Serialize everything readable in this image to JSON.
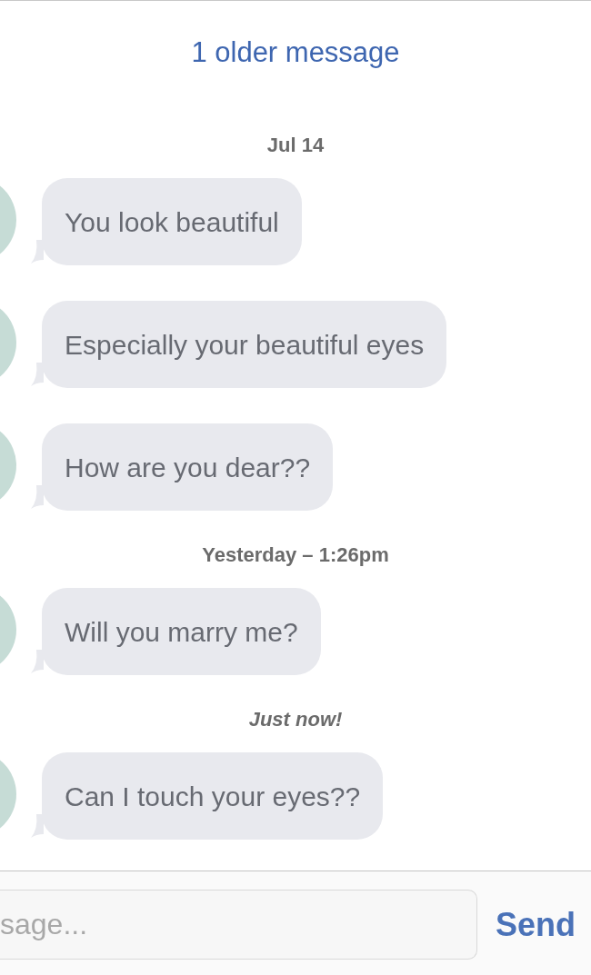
{
  "older_messages_link": "1 older message",
  "thread": [
    {
      "kind": "timestamp",
      "text": "Jul 14",
      "italic": false
    },
    {
      "kind": "message",
      "text": "You look beautiful"
    },
    {
      "kind": "message",
      "text": "Especially your beautiful eyes"
    },
    {
      "kind": "message",
      "text": "How are you dear??"
    },
    {
      "kind": "timestamp",
      "text": "Yesterday – 1:26pm",
      "italic": false
    },
    {
      "kind": "message",
      "text": "Will you marry me?"
    },
    {
      "kind": "timestamp",
      "text": "Just now!",
      "italic": true
    },
    {
      "kind": "message",
      "text": "Can I touch your eyes??"
    }
  ],
  "composer": {
    "placeholder": "sage...",
    "send_button": "Send"
  }
}
